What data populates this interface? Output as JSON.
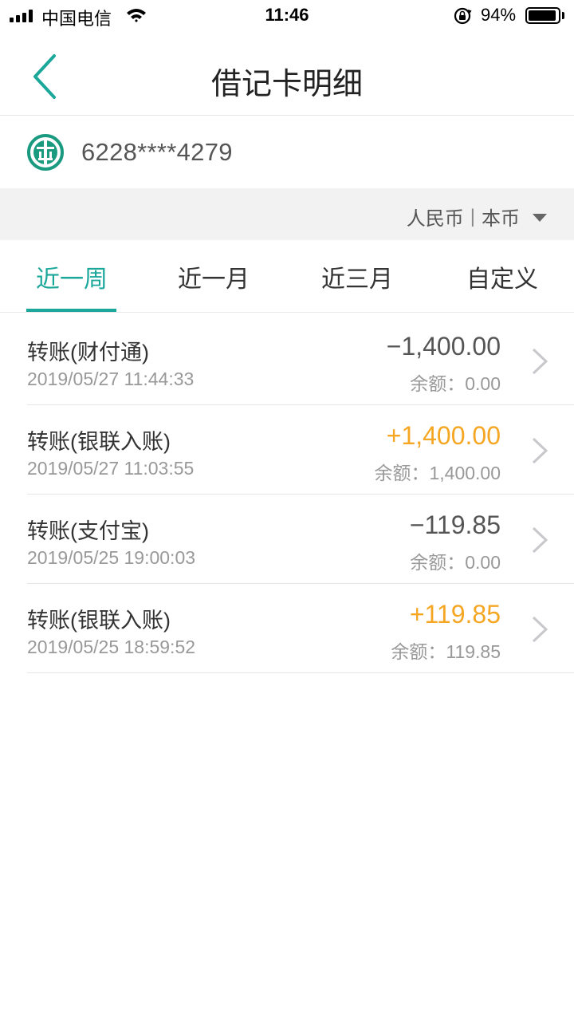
{
  "status_bar": {
    "carrier": "中国电信",
    "time": "11:46",
    "battery_percent": "94%",
    "battery_level": 0.94
  },
  "nav": {
    "title": "借记卡明细",
    "back_icon": "chevron-left-icon"
  },
  "card": {
    "logo_icon": "abc-bank-logo",
    "number": "6228****4279"
  },
  "currency": {
    "label": "人民币",
    "separator": "|",
    "type": "本币"
  },
  "tabs": [
    {
      "label": "近一周",
      "active": true
    },
    {
      "label": "近一月",
      "active": false
    },
    {
      "label": "近三月",
      "active": false
    },
    {
      "label": "自定义",
      "active": false
    }
  ],
  "transactions": [
    {
      "title": "转账(财付通)",
      "datetime": "2019/05/27 11:44:33",
      "amount": "−1,400.00",
      "direction": "out",
      "balance": "余额：0.00"
    },
    {
      "title": "转账(银联入账)",
      "datetime": "2019/05/27 11:03:55",
      "amount": "+1,400.00",
      "direction": "in",
      "balance": "余额：1,400.00"
    },
    {
      "title": "转账(支付宝)",
      "datetime": "2019/05/25 19:00:03",
      "amount": "−119.85",
      "direction": "out",
      "balance": "余额：0.00"
    },
    {
      "title": "转账(银联入账)",
      "datetime": "2019/05/25 18:59:52",
      "amount": "+119.85",
      "direction": "in",
      "balance": "余额：119.85"
    }
  ],
  "colors": {
    "accent": "#1ba89a",
    "income": "#f5a623",
    "expense": "#555555"
  }
}
